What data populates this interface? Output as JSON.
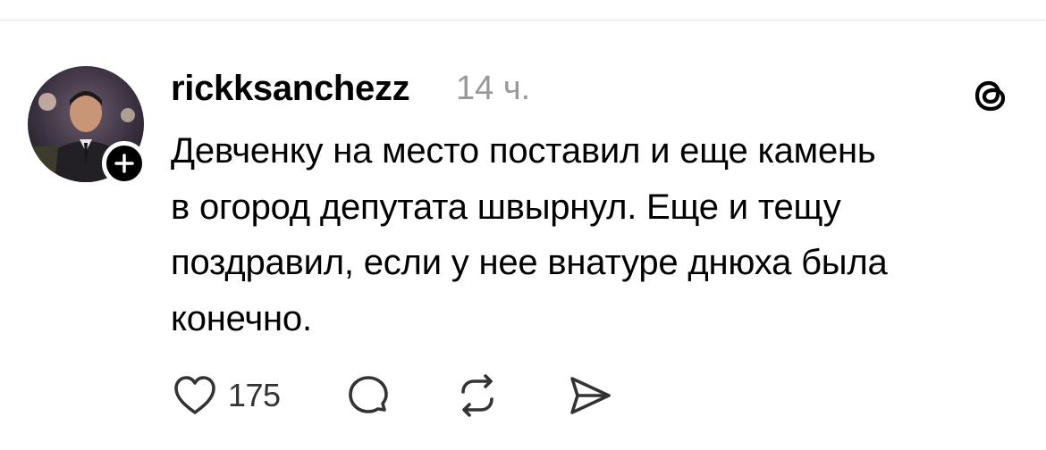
{
  "post": {
    "username": "rickksanchezz",
    "timestamp": "14 ч.",
    "text": "Девченку на место поставил и еще камень\nв огород депутата швырнул. Еще и тещу\nпоздравил, если у нее внатуре днюха была\nконечно."
  },
  "actions": {
    "like_count": "175"
  },
  "icons": {
    "like": "heart-icon",
    "comment": "comment-bubble-icon",
    "repost": "repost-arrows-icon",
    "share": "send-icon",
    "follow": "plus-icon",
    "app": "threads-logo-icon"
  },
  "colors": {
    "text": "#000000",
    "muted": "#999999",
    "icon": "#333333",
    "badge": "#000000"
  }
}
